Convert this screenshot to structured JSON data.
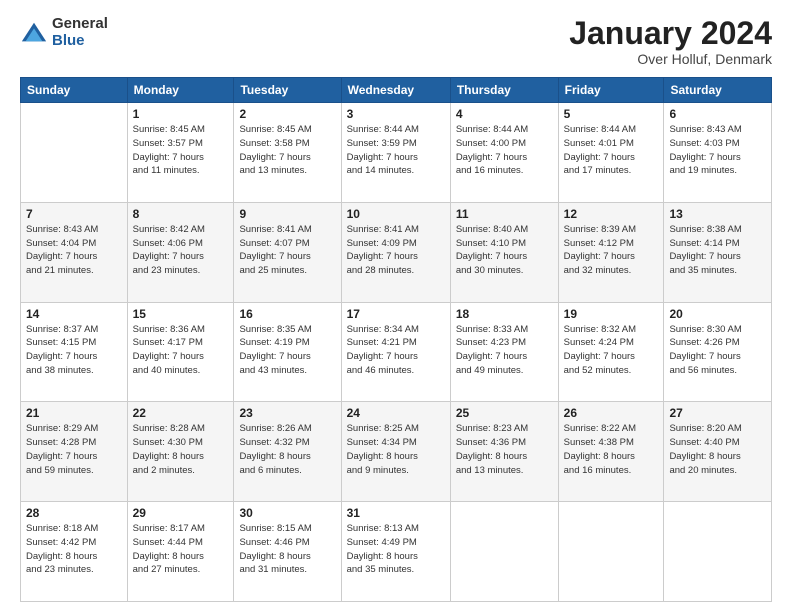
{
  "header": {
    "logo_general": "General",
    "logo_blue": "Blue",
    "month_title": "January 2024",
    "location": "Over Holluf, Denmark"
  },
  "days_of_week": [
    "Sunday",
    "Monday",
    "Tuesday",
    "Wednesday",
    "Thursday",
    "Friday",
    "Saturday"
  ],
  "weeks": [
    [
      {
        "day": "",
        "info": ""
      },
      {
        "day": "1",
        "info": "Sunrise: 8:45 AM\nSunset: 3:57 PM\nDaylight: 7 hours\nand 11 minutes."
      },
      {
        "day": "2",
        "info": "Sunrise: 8:45 AM\nSunset: 3:58 PM\nDaylight: 7 hours\nand 13 minutes."
      },
      {
        "day": "3",
        "info": "Sunrise: 8:44 AM\nSunset: 3:59 PM\nDaylight: 7 hours\nand 14 minutes."
      },
      {
        "day": "4",
        "info": "Sunrise: 8:44 AM\nSunset: 4:00 PM\nDaylight: 7 hours\nand 16 minutes."
      },
      {
        "day": "5",
        "info": "Sunrise: 8:44 AM\nSunset: 4:01 PM\nDaylight: 7 hours\nand 17 minutes."
      },
      {
        "day": "6",
        "info": "Sunrise: 8:43 AM\nSunset: 4:03 PM\nDaylight: 7 hours\nand 19 minutes."
      }
    ],
    [
      {
        "day": "7",
        "info": "Sunrise: 8:43 AM\nSunset: 4:04 PM\nDaylight: 7 hours\nand 21 minutes."
      },
      {
        "day": "8",
        "info": "Sunrise: 8:42 AM\nSunset: 4:06 PM\nDaylight: 7 hours\nand 23 minutes."
      },
      {
        "day": "9",
        "info": "Sunrise: 8:41 AM\nSunset: 4:07 PM\nDaylight: 7 hours\nand 25 minutes."
      },
      {
        "day": "10",
        "info": "Sunrise: 8:41 AM\nSunset: 4:09 PM\nDaylight: 7 hours\nand 28 minutes."
      },
      {
        "day": "11",
        "info": "Sunrise: 8:40 AM\nSunset: 4:10 PM\nDaylight: 7 hours\nand 30 minutes."
      },
      {
        "day": "12",
        "info": "Sunrise: 8:39 AM\nSunset: 4:12 PM\nDaylight: 7 hours\nand 32 minutes."
      },
      {
        "day": "13",
        "info": "Sunrise: 8:38 AM\nSunset: 4:14 PM\nDaylight: 7 hours\nand 35 minutes."
      }
    ],
    [
      {
        "day": "14",
        "info": "Sunrise: 8:37 AM\nSunset: 4:15 PM\nDaylight: 7 hours\nand 38 minutes."
      },
      {
        "day": "15",
        "info": "Sunrise: 8:36 AM\nSunset: 4:17 PM\nDaylight: 7 hours\nand 40 minutes."
      },
      {
        "day": "16",
        "info": "Sunrise: 8:35 AM\nSunset: 4:19 PM\nDaylight: 7 hours\nand 43 minutes."
      },
      {
        "day": "17",
        "info": "Sunrise: 8:34 AM\nSunset: 4:21 PM\nDaylight: 7 hours\nand 46 minutes."
      },
      {
        "day": "18",
        "info": "Sunrise: 8:33 AM\nSunset: 4:23 PM\nDaylight: 7 hours\nand 49 minutes."
      },
      {
        "day": "19",
        "info": "Sunrise: 8:32 AM\nSunset: 4:24 PM\nDaylight: 7 hours\nand 52 minutes."
      },
      {
        "day": "20",
        "info": "Sunrise: 8:30 AM\nSunset: 4:26 PM\nDaylight: 7 hours\nand 56 minutes."
      }
    ],
    [
      {
        "day": "21",
        "info": "Sunrise: 8:29 AM\nSunset: 4:28 PM\nDaylight: 7 hours\nand 59 minutes."
      },
      {
        "day": "22",
        "info": "Sunrise: 8:28 AM\nSunset: 4:30 PM\nDaylight: 8 hours\nand 2 minutes."
      },
      {
        "day": "23",
        "info": "Sunrise: 8:26 AM\nSunset: 4:32 PM\nDaylight: 8 hours\nand 6 minutes."
      },
      {
        "day": "24",
        "info": "Sunrise: 8:25 AM\nSunset: 4:34 PM\nDaylight: 8 hours\nand 9 minutes."
      },
      {
        "day": "25",
        "info": "Sunrise: 8:23 AM\nSunset: 4:36 PM\nDaylight: 8 hours\nand 13 minutes."
      },
      {
        "day": "26",
        "info": "Sunrise: 8:22 AM\nSunset: 4:38 PM\nDaylight: 8 hours\nand 16 minutes."
      },
      {
        "day": "27",
        "info": "Sunrise: 8:20 AM\nSunset: 4:40 PM\nDaylight: 8 hours\nand 20 minutes."
      }
    ],
    [
      {
        "day": "28",
        "info": "Sunrise: 8:18 AM\nSunset: 4:42 PM\nDaylight: 8 hours\nand 23 minutes."
      },
      {
        "day": "29",
        "info": "Sunrise: 8:17 AM\nSunset: 4:44 PM\nDaylight: 8 hours\nand 27 minutes."
      },
      {
        "day": "30",
        "info": "Sunrise: 8:15 AM\nSunset: 4:46 PM\nDaylight: 8 hours\nand 31 minutes."
      },
      {
        "day": "31",
        "info": "Sunrise: 8:13 AM\nSunset: 4:49 PM\nDaylight: 8 hours\nand 35 minutes."
      },
      {
        "day": "",
        "info": ""
      },
      {
        "day": "",
        "info": ""
      },
      {
        "day": "",
        "info": ""
      }
    ]
  ]
}
